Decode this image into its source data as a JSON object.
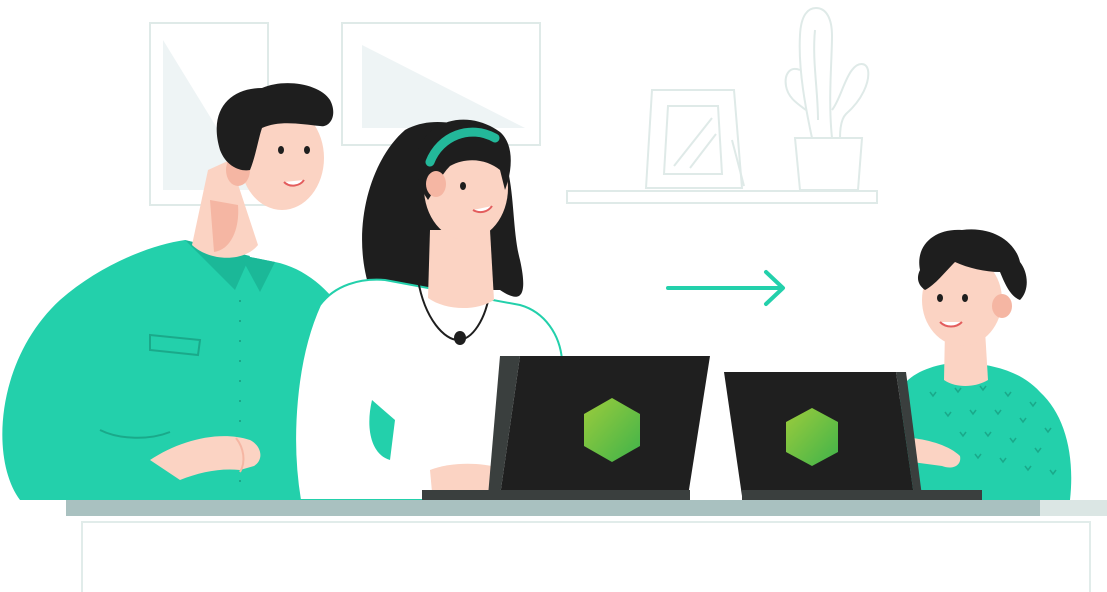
{
  "scene": {
    "description_kind": "illustration",
    "colors": {
      "background": "#ffffff",
      "outline": "#e1ecea",
      "frame_fill": "#eef4f5",
      "green": "#23d0ab",
      "green_dark": "#1bb898",
      "hair": "#1e1e1e",
      "skin": "#fbd3c3",
      "skin_shadow": "#f5b6a3",
      "laptop": "#1f1f1f",
      "laptop_base": "#3a3f3e",
      "logo_a": "#8cc63f",
      "logo_b": "#39b54a",
      "desk_top": "#a9c1c0",
      "desk_edge": "#dbe6e4"
    },
    "icons": {
      "laptop_logo": "hexagon-icon",
      "transfer_arrow": "arrow-right-icon"
    }
  }
}
